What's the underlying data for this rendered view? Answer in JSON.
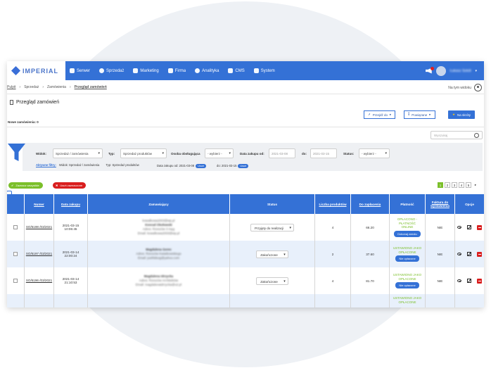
{
  "brand": {
    "name": "IMPERIAL"
  },
  "nav": [
    "Serwer",
    "Sprzedaż",
    "Marketing",
    "Firma",
    "Analityka",
    "CMS",
    "System"
  ],
  "user": {
    "name": "Łukasz Sokół"
  },
  "breadcrumb": [
    "Pulpit",
    "Sprzedaż",
    "Zamówienia",
    "Przegląd zamówień"
  ],
  "widget_link": "Na tym widoku",
  "page_title": "Przegląd zamówień",
  "buttons": {
    "go_to": "Przejdź do",
    "related": "Powiązane",
    "shortcuts": "Na skróty"
  },
  "new_orders": "Nowe zamówienia: 0",
  "search_placeholder": "Wyszukaj",
  "filters": {
    "view_label": "Widok:",
    "view_value": "Sprzedaż / zamówienia",
    "type_label": "Typ:",
    "type_value": "Sprzedaż produktów",
    "person_label": "Osoba obsługująca",
    "person_value": "- wybierz -",
    "date_from_label": "Data zakupu od:",
    "date_from_value": "2021-03-08",
    "date_to_label": "do:",
    "date_to_value": "2021-03-15",
    "status_label": "Status:",
    "status_value": "- wybierz -"
  },
  "active_filters": {
    "title": "Aktywne filtry:",
    "view": "Widok: Sprzedaż / zamówienia",
    "type": "Typ: Sprzedaż produktów",
    "date_from": "Data zakupu od: 2021-03-08",
    "date_to": "do: 2021-03-15",
    "remove": "Usuń"
  },
  "bulk": {
    "mark_all": "Zaznacz wszystkie",
    "unmark": "Usuń zaznaczone"
  },
  "pagination": [
    "1",
    "2",
    "3",
    "4",
    "5",
    "▸"
  ],
  "table": {
    "headers": [
      "Numer",
      "Data zakupu",
      "Zamawiający",
      "Status",
      "Liczba produktów",
      "Do zapłacenia",
      "Płatność",
      "Faktura do wystawienia",
      "Opcje"
    ],
    "rows": [
      {
        "number": "SO/5198 /03/2021",
        "date": "2021-03-15",
        "time": "10:06:45",
        "cust1": "kowalkowa2003@wp.pl",
        "cust2": "Konrad Okołowski",
        "cust3": "Adres: Rzeszów 3 męg",
        "cust4": "Email: kowalkowa2003@wp.pl",
        "status": "Przyjęty do realizacji",
        "qty": "4",
        "amount": "66.20",
        "pay1": "OPŁACONO - PŁATNOŚĆ",
        "pay2": "ONLINE",
        "pay_btn": "Dokonaj zwrotu",
        "invoice": "NIE"
      },
      {
        "number": "SO/5197 /03/2021",
        "date": "2021-03-14",
        "time": "22:00:24",
        "cust1": "",
        "cust2": "Magdalena Gorec",
        "cust3": "Adres: Rzeszów Kwiatkowskiego",
        "cust4": "Email: justhldsog@yahoo.com",
        "status": "Zakończone",
        "qty": "2",
        "amount": "37.60",
        "pay1": "USTAWIONO JAKO",
        "pay2": "OPŁACONE",
        "pay_btn": "Nie opłacone",
        "invoice": "NIE"
      },
      {
        "number": "SO/5196 /03/2021",
        "date": "2021-03-14",
        "time": "21:10:53",
        "cust1": "",
        "cust2": "Magdalena Idrzycka",
        "cust3": "Adres: Rzeszów Architektów",
        "cust4": "Email: magdalenaidrzycka@o2.pl",
        "status": "Zakończone",
        "qty": "4",
        "amount": "81.70",
        "pay1": "USTAWIONO JAKO",
        "pay2": "OPŁACONE",
        "pay_btn": "Nie opłacone",
        "invoice": "NIE"
      },
      {
        "number": "",
        "date": "",
        "time": "",
        "cust1": "",
        "cust2": "",
        "cust3": "",
        "cust4": "",
        "status": "",
        "qty": "",
        "amount": "",
        "pay1": "USTAWIONO JAKO",
        "pay2": "OPŁACONE",
        "pay_btn": "",
        "invoice": ""
      }
    ]
  },
  "colors": {
    "primary": "#3471d6",
    "success": "#7bbf2a",
    "danger": "#d91e1e",
    "row_alt": "#e8f0fb"
  }
}
